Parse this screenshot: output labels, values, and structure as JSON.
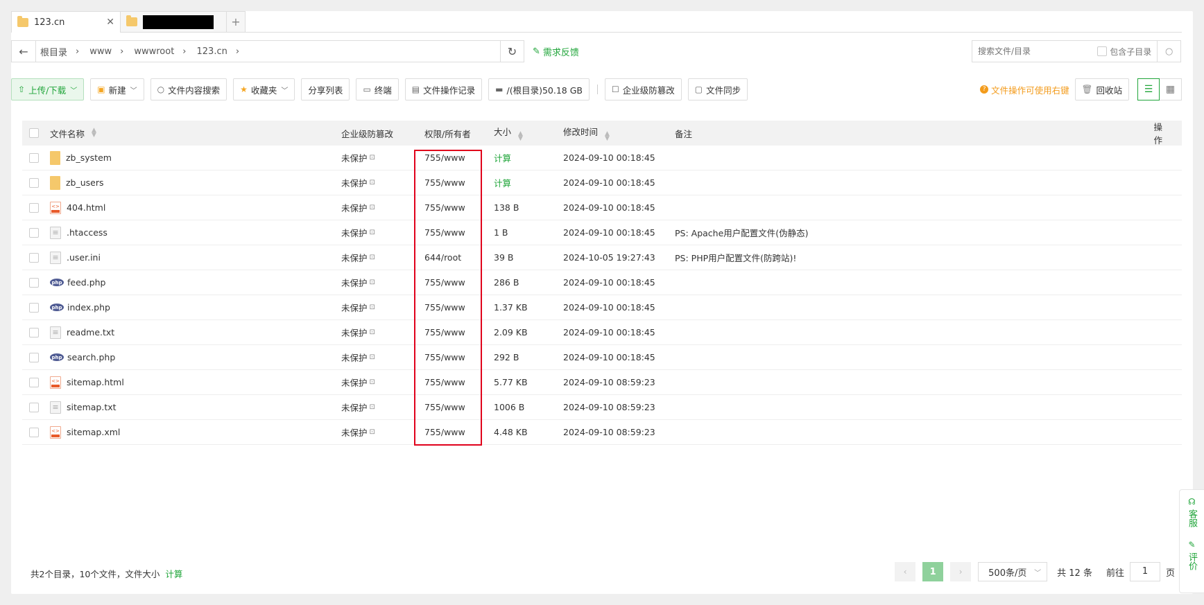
{
  "tabs": [
    {
      "label": "123.cn",
      "active": true,
      "close": "✕"
    },
    {
      "label": "",
      "active": false
    }
  ],
  "tab_add": "+",
  "path": {
    "crumbs": [
      "根目录",
      "www",
      "wwwroot",
      "123.cn"
    ],
    "feedback": "需求反馈"
  },
  "search": {
    "placeholder": "搜索文件/目录",
    "include_sub": "包含子目录"
  },
  "toolbar": {
    "upload": "上传/下载",
    "new": "新建",
    "content_search": "文件内容搜索",
    "favorites": "收藏夹",
    "share_list": "分享列表",
    "terminal": "终端",
    "op_log": "文件操作记录",
    "disk": "/(根目录)50.18 GB",
    "tamper": "企业级防篡改",
    "sync": "文件同步",
    "hint": "文件操作可使用右键",
    "recycle": "回收站"
  },
  "table": {
    "headers": {
      "name": "文件名称",
      "protect": "企业级防篡改",
      "perm": "权限/所有者",
      "size": "大小",
      "mtime": "修改时间",
      "note": "备注",
      "op": "操作"
    },
    "rows": [
      {
        "name": "zb_system",
        "type": "folder",
        "protect": "未保护",
        "perm": "755/www",
        "size": "计算",
        "mtime": "2024-09-10 00:18:45",
        "note": ""
      },
      {
        "name": "zb_users",
        "type": "folder",
        "protect": "未保护",
        "perm": "755/www",
        "size": "计算",
        "mtime": "2024-09-10 00:18:45",
        "note": ""
      },
      {
        "name": "404.html",
        "type": "html",
        "protect": "未保护",
        "perm": "755/www",
        "size": "138 B",
        "mtime": "2024-09-10 00:18:45",
        "note": ""
      },
      {
        "name": ".htaccess",
        "type": "text",
        "protect": "未保护",
        "perm": "755/www",
        "size": "1 B",
        "mtime": "2024-09-10 00:18:45",
        "note": "PS: Apache用户配置文件(伪静态)"
      },
      {
        "name": ".user.ini",
        "type": "text",
        "protect": "未保护",
        "perm": "644/root",
        "size": "39 B",
        "mtime": "2024-10-05 19:27:43",
        "note": "PS: PHP用户配置文件(防跨站)!"
      },
      {
        "name": "feed.php",
        "type": "php",
        "protect": "未保护",
        "perm": "755/www",
        "size": "286 B",
        "mtime": "2024-09-10 00:18:45",
        "note": ""
      },
      {
        "name": "index.php",
        "type": "php",
        "protect": "未保护",
        "perm": "755/www",
        "size": "1.37 KB",
        "mtime": "2024-09-10 00:18:45",
        "note": ""
      },
      {
        "name": "readme.txt",
        "type": "text",
        "protect": "未保护",
        "perm": "755/www",
        "size": "2.09 KB",
        "mtime": "2024-09-10 00:18:45",
        "note": ""
      },
      {
        "name": "search.php",
        "type": "php",
        "protect": "未保护",
        "perm": "755/www",
        "size": "292 B",
        "mtime": "2024-09-10 00:18:45",
        "note": ""
      },
      {
        "name": "sitemap.html",
        "type": "html",
        "protect": "未保护",
        "perm": "755/www",
        "size": "5.77 KB",
        "mtime": "2024-09-10 08:59:23",
        "note": ""
      },
      {
        "name": "sitemap.txt",
        "type": "text",
        "protect": "未保护",
        "perm": "755/www",
        "size": "1006 B",
        "mtime": "2024-09-10 08:59:23",
        "note": ""
      },
      {
        "name": "sitemap.xml",
        "type": "html",
        "protect": "未保护",
        "perm": "755/www",
        "size": "4.48 KB",
        "mtime": "2024-09-10 08:59:23",
        "note": ""
      }
    ]
  },
  "footer": {
    "summary": "共2个目录，10个文件，文件大小",
    "calc": "计算",
    "current_page": "1",
    "page_size": "500条/页",
    "total": "共 12 条",
    "goto_prefix": "前往",
    "goto_value": "1",
    "goto_suffix": "页"
  },
  "side": {
    "service": "客服",
    "review": "评价"
  },
  "colors": {
    "accent": "#20a53a",
    "warning": "#f39b1b",
    "highlight_box": "#e0001b"
  }
}
